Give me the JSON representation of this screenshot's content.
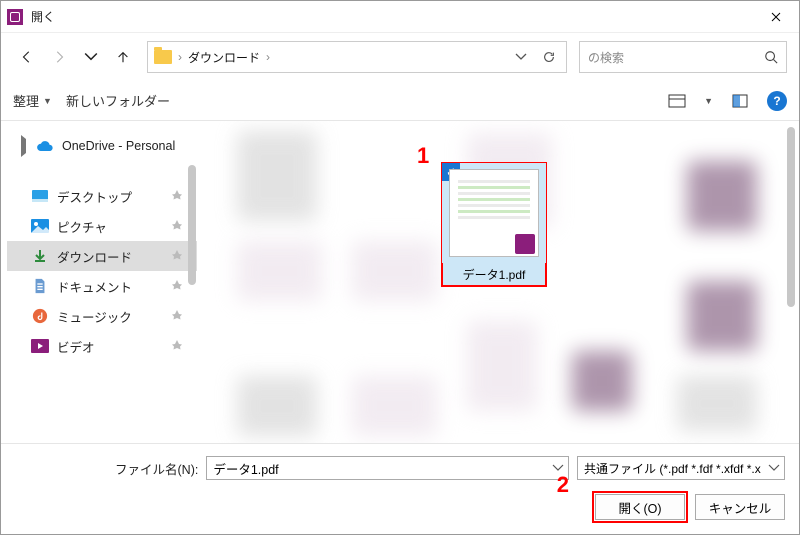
{
  "title": "開く",
  "breadcrumb": {
    "root": "ダウンロード",
    "sep": "›"
  },
  "search": {
    "placeholder": "の検索"
  },
  "toolbar": {
    "organize": "整理",
    "newfolder": "新しいフォルダー"
  },
  "sidebar": {
    "onedrive": "OneDrive - Personal",
    "items": [
      {
        "label": "デスクトップ"
      },
      {
        "label": "ピクチャ"
      },
      {
        "label": "ダウンロード"
      },
      {
        "label": "ドキュメント"
      },
      {
        "label": "ミュージック"
      },
      {
        "label": "ビデオ"
      }
    ]
  },
  "selected_file": {
    "name": "データ1.pdf"
  },
  "footer": {
    "filename_label": "ファイル名(N):",
    "filename_value": "データ1.pdf",
    "filter": "共通ファイル (*.pdf *.fdf *.xfdf *.x",
    "open": "開く(O)",
    "cancel": "キャンセル"
  },
  "annotations": {
    "one": "1",
    "two": "2"
  }
}
